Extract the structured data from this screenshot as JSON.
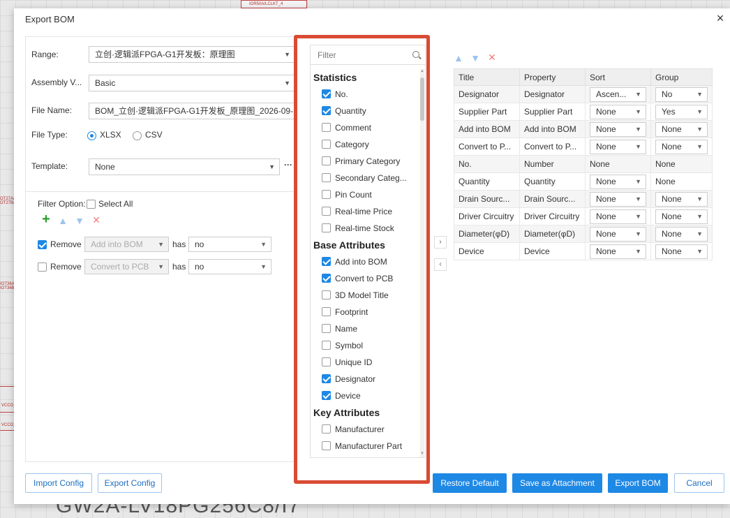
{
  "background": {
    "title": "GW2A-LV18PG256C8/I7",
    "labels": [
      "IOR50A/LCLKT_4",
      "VCCO_",
      "VCCO_",
      "OT27A/",
      "OT27B/",
      "IOT36A/",
      "IOT36B/"
    ]
  },
  "dialog": {
    "title": "Export BOM",
    "close_icon": "close-icon"
  },
  "form": {
    "range_label": "Range:",
    "range_value": "立创·逻辑派FPGA-G1开发板：原理图",
    "assembly_label": "Assembly V...",
    "assembly_value": "Basic",
    "filename_label": "File Name:",
    "filename_value": "BOM_立创·逻辑派FPGA-G1开发板_原理图_2026-09-",
    "filetype_label": "File Type:",
    "filetype_xlsx": "XLSX",
    "filetype_csv": "CSV",
    "filetype_selected": "XLSX",
    "template_label": "Template:",
    "template_value": "None",
    "template_more": "···"
  },
  "filter_options": {
    "label": "Filter Option:",
    "select_all": "Select All",
    "rows": [
      {
        "checked": true,
        "action": "Remove",
        "property": "Add into BOM",
        "op": "has",
        "value": "no"
      },
      {
        "checked": false,
        "action": "Remove",
        "property": "Convert to PCB",
        "op": "has",
        "value": "no"
      }
    ]
  },
  "column_picker": {
    "filter_placeholder": "Filter",
    "groups": [
      {
        "name": "Statistics",
        "items": [
          {
            "label": "No.",
            "checked": true
          },
          {
            "label": "Quantity",
            "checked": true
          },
          {
            "label": "Comment",
            "checked": false
          },
          {
            "label": "Category",
            "checked": false
          },
          {
            "label": "Primary Category",
            "checked": false
          },
          {
            "label": "Secondary Categ...",
            "checked": false
          },
          {
            "label": "Pin Count",
            "checked": false
          },
          {
            "label": "Real-time Price",
            "checked": false
          },
          {
            "label": "Real-time Stock",
            "checked": false
          }
        ]
      },
      {
        "name": "Base Attributes",
        "items": [
          {
            "label": "Add into BOM",
            "checked": true
          },
          {
            "label": "Convert to PCB",
            "checked": true
          },
          {
            "label": "3D Model Title",
            "checked": false
          },
          {
            "label": "Footprint",
            "checked": false
          },
          {
            "label": "Name",
            "checked": false
          },
          {
            "label": "Symbol",
            "checked": false
          },
          {
            "label": "Unique ID",
            "checked": false
          },
          {
            "label": "Designator",
            "checked": true
          },
          {
            "label": "Device",
            "checked": true
          }
        ]
      },
      {
        "name": "Key Attributes",
        "items": [
          {
            "label": "Manufacturer",
            "checked": false
          },
          {
            "label": "Manufacturer Part",
            "checked": false
          }
        ]
      }
    ]
  },
  "transfer": {
    "right": "›",
    "left": "‹"
  },
  "columns_table": {
    "headers": [
      "Title",
      "Property",
      "Sort",
      "Group"
    ],
    "rows": [
      {
        "title": "Designator",
        "property": "Designator",
        "sort": "Ascen...",
        "sort_select": true,
        "group": "No",
        "group_select": true
      },
      {
        "title": "Supplier Part",
        "property": "Supplier Part",
        "sort": "None",
        "sort_select": true,
        "group": "Yes",
        "group_select": true
      },
      {
        "title": "Add into BOM",
        "property": "Add into BOM",
        "sort": "None",
        "sort_select": true,
        "group": "None",
        "group_select": true
      },
      {
        "title": "Convert to P...",
        "property": "Convert to P...",
        "sort": "None",
        "sort_select": true,
        "group": "None",
        "group_select": true
      },
      {
        "title": "No.",
        "property": "Number",
        "sort": "None",
        "sort_select": false,
        "group": "None",
        "group_select": false
      },
      {
        "title": "Quantity",
        "property": "Quantity",
        "sort": "None",
        "sort_select": true,
        "group": "None",
        "group_select": false
      },
      {
        "title": "Drain Sourc...",
        "property": "Drain Sourc...",
        "sort": "None",
        "sort_select": true,
        "group": "None",
        "group_select": true
      },
      {
        "title": "Driver Circuitry",
        "property": "Driver Circuitry",
        "sort": "None",
        "sort_select": true,
        "group": "None",
        "group_select": true
      },
      {
        "title": "Diameter(φD)",
        "property": "Diameter(φD)",
        "sort": "None",
        "sort_select": true,
        "group": "None",
        "group_select": true
      },
      {
        "title": "Device",
        "property": "Device",
        "sort": "None",
        "sort_select": true,
        "group": "None",
        "group_select": true
      }
    ]
  },
  "footer": {
    "import_config": "Import Config",
    "export_config": "Export Config",
    "restore_default": "Restore Default",
    "save_attachment": "Save as Attachment",
    "export_bom": "Export BOM",
    "cancel": "Cancel"
  },
  "colors": {
    "accent": "#1e88e5",
    "highlight": "#d94b34",
    "add": "#2a9d2a",
    "delete": "#f08080",
    "arrow": "#9cc4ee"
  }
}
